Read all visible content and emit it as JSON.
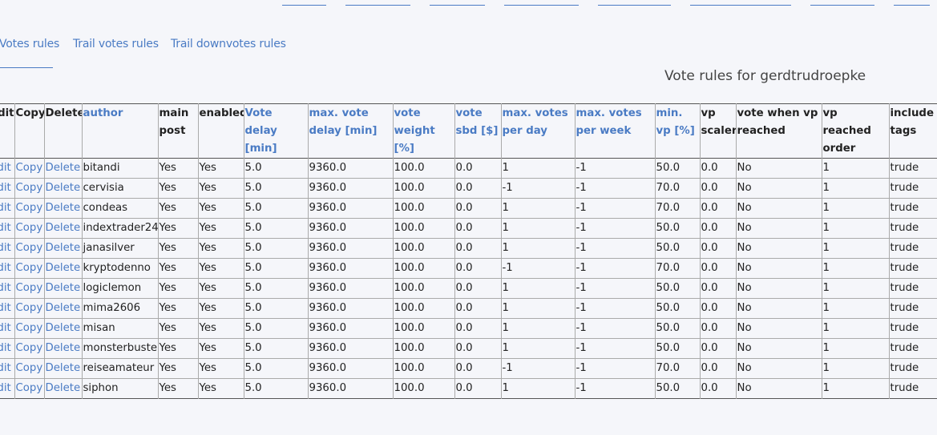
{
  "subtabs": [
    {
      "label": "Votes rules",
      "active": true
    },
    {
      "label": "Trail votes rules",
      "active": false
    },
    {
      "label": "Trail downvotes rules",
      "active": false
    }
  ],
  "page_title": "Vote rules for gerdtrudroepke",
  "table": {
    "columns": [
      "Edit",
      "Copy",
      "Delete",
      "author",
      "main post",
      "enabled",
      "Vote delay [min]",
      "max. vote delay [min]",
      "vote weight [%]",
      "vote sbd [$]",
      "max. votes per day",
      "max. votes per week",
      "min. vp [%]",
      "vp scaler",
      "vote when vp reached",
      "vp reached order",
      "include tags"
    ],
    "sortable": [
      false,
      false,
      false,
      true,
      false,
      false,
      true,
      true,
      true,
      true,
      true,
      true,
      true,
      false,
      false,
      false,
      false
    ],
    "actions": {
      "edit": "Edit",
      "copy": "Copy",
      "delete": "Delete"
    },
    "rows": [
      [
        "bitandi",
        "Yes",
        "Yes",
        "5.0",
        "9360.0",
        "100.0",
        "0.0",
        "1",
        "-1",
        "50.0",
        "0.0",
        "No",
        "1",
        "trude"
      ],
      [
        "cervisia",
        "Yes",
        "Yes",
        "5.0",
        "9360.0",
        "100.0",
        "0.0",
        "-1",
        "-1",
        "70.0",
        "0.0",
        "No",
        "1",
        "trude"
      ],
      [
        "condeas",
        "Yes",
        "Yes",
        "5.0",
        "9360.0",
        "100.0",
        "0.0",
        "1",
        "-1",
        "70.0",
        "0.0",
        "No",
        "1",
        "trude"
      ],
      [
        "indextrader24",
        "Yes",
        "Yes",
        "5.0",
        "9360.0",
        "100.0",
        "0.0",
        "1",
        "-1",
        "50.0",
        "0.0",
        "No",
        "1",
        "trude"
      ],
      [
        "janasilver",
        "Yes",
        "Yes",
        "5.0",
        "9360.0",
        "100.0",
        "0.0",
        "1",
        "-1",
        "50.0",
        "0.0",
        "No",
        "1",
        "trude"
      ],
      [
        "kryptodenno",
        "Yes",
        "Yes",
        "5.0",
        "9360.0",
        "100.0",
        "0.0",
        "-1",
        "-1",
        "70.0",
        "0.0",
        "No",
        "1",
        "trude"
      ],
      [
        "logiclemon",
        "Yes",
        "Yes",
        "5.0",
        "9360.0",
        "100.0",
        "0.0",
        "1",
        "-1",
        "50.0",
        "0.0",
        "No",
        "1",
        "trude"
      ],
      [
        "mima2606",
        "Yes",
        "Yes",
        "5.0",
        "9360.0",
        "100.0",
        "0.0",
        "1",
        "-1",
        "50.0",
        "0.0",
        "No",
        "1",
        "trude"
      ],
      [
        "misan",
        "Yes",
        "Yes",
        "5.0",
        "9360.0",
        "100.0",
        "0.0",
        "1",
        "-1",
        "50.0",
        "0.0",
        "No",
        "1",
        "trude"
      ],
      [
        "monsterbuster",
        "Yes",
        "Yes",
        "5.0",
        "9360.0",
        "100.0",
        "0.0",
        "1",
        "-1",
        "50.0",
        "0.0",
        "No",
        "1",
        "trude"
      ],
      [
        "reiseamateur",
        "Yes",
        "Yes",
        "5.0",
        "9360.0",
        "100.0",
        "0.0",
        "-1",
        "-1",
        "70.0",
        "0.0",
        "No",
        "1",
        "trude"
      ],
      [
        "siphon",
        "Yes",
        "Yes",
        "5.0",
        "9360.0",
        "100.0",
        "0.0",
        "1",
        "-1",
        "50.0",
        "0.0",
        "No",
        "1",
        "trude"
      ]
    ]
  },
  "colors": {
    "link": "#4a7bc4",
    "background": "#f5f6fa"
  }
}
